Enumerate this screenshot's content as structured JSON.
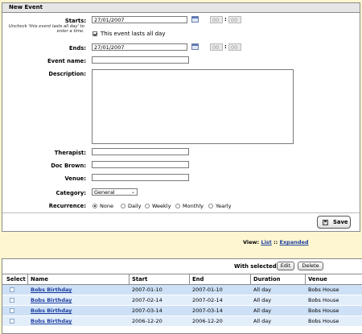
{
  "form": {
    "title": "New Event",
    "starts_label": "Starts:",
    "starts_date": "27/01/2007",
    "starts_hour": "00",
    "starts_minute": "00",
    "allday_hint": "Uncheck 'this event lasts all day' to enter a time.",
    "allday_label": "This event lasts all day",
    "allday_checked": true,
    "ends_label": "Ends:",
    "ends_date": "27/01/2007",
    "ends_hour": "00",
    "ends_minute": "00",
    "event_name_label": "Event name:",
    "event_name_value": "",
    "description_label": "Description:",
    "therapist_label": "Therapist:",
    "doc_brown_label": "Doc Brown:",
    "venue_label": "Venue:",
    "category_label": "Category:",
    "category_value": "General",
    "recurrence_label": "Recurrence:",
    "recurrence_options": [
      "None",
      "Daily",
      "Weekly",
      "Monthly",
      "Yearly"
    ],
    "recurrence_selected": "None",
    "save_label": "Save"
  },
  "view": {
    "prefix": "View:",
    "list": "List",
    "separator": "::",
    "expanded": "Expanded"
  },
  "table": {
    "with_selected_label": "With selected:",
    "edit_label": "Edit",
    "delete_label": "Delete",
    "headers": [
      "Select",
      "Name",
      "Start",
      "End",
      "Duration",
      "Venue"
    ],
    "rows": [
      {
        "name": "Bobs Birthday",
        "start": "2007-01-10",
        "end": "2007-01-10",
        "duration": "All day",
        "venue": "Bobs House"
      },
      {
        "name": "Bobs Birthday",
        "start": "2007-02-14",
        "end": "2007-02-14",
        "duration": "All day",
        "venue": "Bobs House"
      },
      {
        "name": "Bobs Birthday",
        "start": "2007-03-14",
        "end": "2007-03-14",
        "duration": "All day",
        "venue": "Bobs House"
      },
      {
        "name": "Bobs Birthday",
        "start": "2006-12-20",
        "end": "2006-12-20",
        "duration": "All day",
        "venue": "Bobs House"
      }
    ]
  },
  "colors": {
    "page_background": "#fdf6d0",
    "link": "#1f3fa0",
    "row_alt_dark": "#cde0f5",
    "row_alt_light": "#e3eefb"
  }
}
